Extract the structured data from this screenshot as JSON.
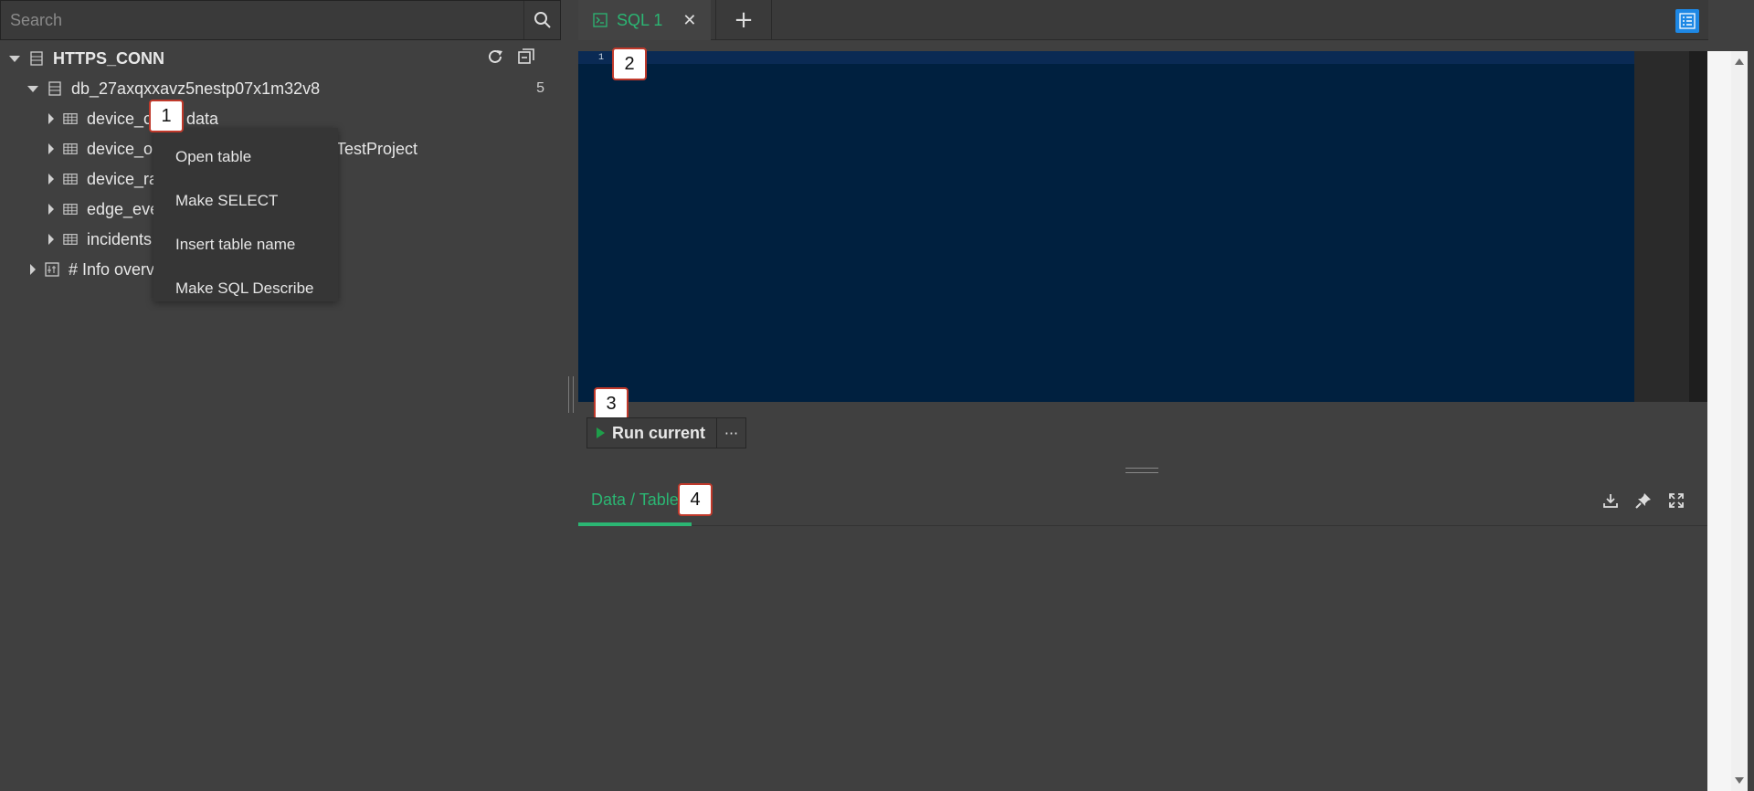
{
  "search": {
    "placeholder": "Search"
  },
  "tree": {
    "connection": "HTTPS_CONN",
    "database": "db_27axqxxavz5nestp07x1m32v8",
    "db_count": "5",
    "tables": [
      "device_c",
      "data",
      "device_o",
      "TestProject",
      "device_ra",
      "edge_eve",
      "incidents",
      "# Info overv"
    ]
  },
  "context_menu": {
    "items": [
      "Open table",
      "Make SELECT",
      "Insert table name",
      "Make SQL Describe"
    ]
  },
  "editor": {
    "tab_label": "SQL 1",
    "line_number": "1"
  },
  "toolbar": {
    "run_label": "Run current",
    "more_label": "···"
  },
  "results": {
    "tab_label": "Data / Table"
  },
  "badges": [
    "1",
    "2",
    "3",
    "4"
  ],
  "colors": {
    "accent": "#2bb673",
    "editor_bg": "#00203f",
    "badge_border": "#c0392b"
  }
}
